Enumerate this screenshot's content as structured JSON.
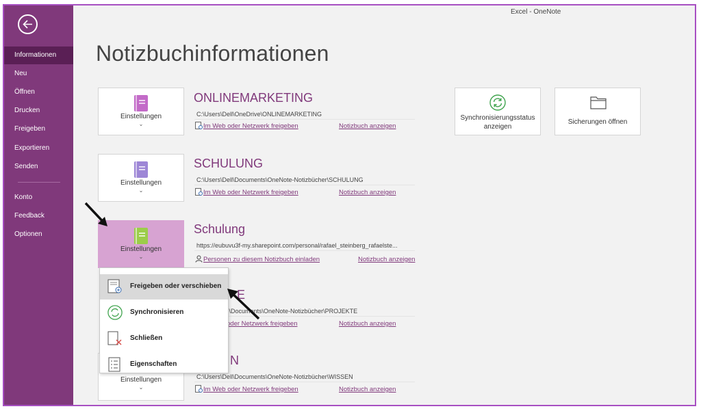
{
  "window": {
    "title": "Excel  -  OneNote"
  },
  "sidebar": {
    "items": [
      {
        "label": "Informationen"
      },
      {
        "label": "Neu"
      },
      {
        "label": "Öffnen"
      },
      {
        "label": "Drucken"
      },
      {
        "label": "Freigeben"
      },
      {
        "label": "Exportieren"
      },
      {
        "label": "Senden"
      },
      {
        "label": "Konto"
      },
      {
        "label": "Feedback"
      },
      {
        "label": "Optionen"
      }
    ]
  },
  "page": {
    "title": "Notizbuchinformationen"
  },
  "notebooks": [
    {
      "name": "ONLINEMARKETING",
      "path": "C:\\Users\\Dell\\OneDrive\\ONLINEMARKETING",
      "settings_label": "Einstellungen",
      "share_link": "Im Web oder Netzwerk freigeben",
      "view_link": "Notizbuch anzeigen",
      "color": "#c36bc8"
    },
    {
      "name": "SCHULUNG",
      "path": "C:\\Users\\Dell\\Documents\\OneNote-Notizbücher\\SCHULUNG",
      "settings_label": "Einstellungen",
      "share_link": "Im Web oder Netzwerk freigeben",
      "view_link": "Notizbuch anzeigen",
      "color": "#9d86d6"
    },
    {
      "name": "Schulung",
      "path": "https://eubuvu3f-my.sharepoint.com/personal/rafael_steinberg_rafaelste...",
      "settings_label": "Einstellungen",
      "share_link": "Personen zu diesem Notizbuch einladen",
      "view_link": "Notizbuch anzeigen",
      "color": "#9ccd4a"
    },
    {
      "name": "E",
      "path": "Dell\\Documents\\OneNote-Notizbücher\\PROJEKTE",
      "settings_label": "",
      "share_link": "oder Netzwerk freigeben",
      "view_link": "Notizbuch anzeigen"
    },
    {
      "name": "N",
      "path": "C:\\Users\\Dell\\Documents\\OneNote-Notizbücher\\WISSEN",
      "settings_label": "Einstellungen",
      "share_link": "Im Web oder Netzwerk freigeben",
      "view_link": "Notizbuch anzeigen"
    }
  ],
  "tiles": {
    "sync_status": "Synchronisierungsstatus anzeigen",
    "backups": "Sicherungen öffnen"
  },
  "dropdown": {
    "items": [
      {
        "label": "Freigeben oder verschieben"
      },
      {
        "label": "Synchronisieren"
      },
      {
        "label": "Schließen"
      },
      {
        "label": "Eigenschaften"
      }
    ]
  },
  "colors": {
    "accent": "#80397b",
    "sidebar_active": "#5a1f55",
    "highlight": "#d7a3d2",
    "sync_green": "#3fa34d"
  }
}
